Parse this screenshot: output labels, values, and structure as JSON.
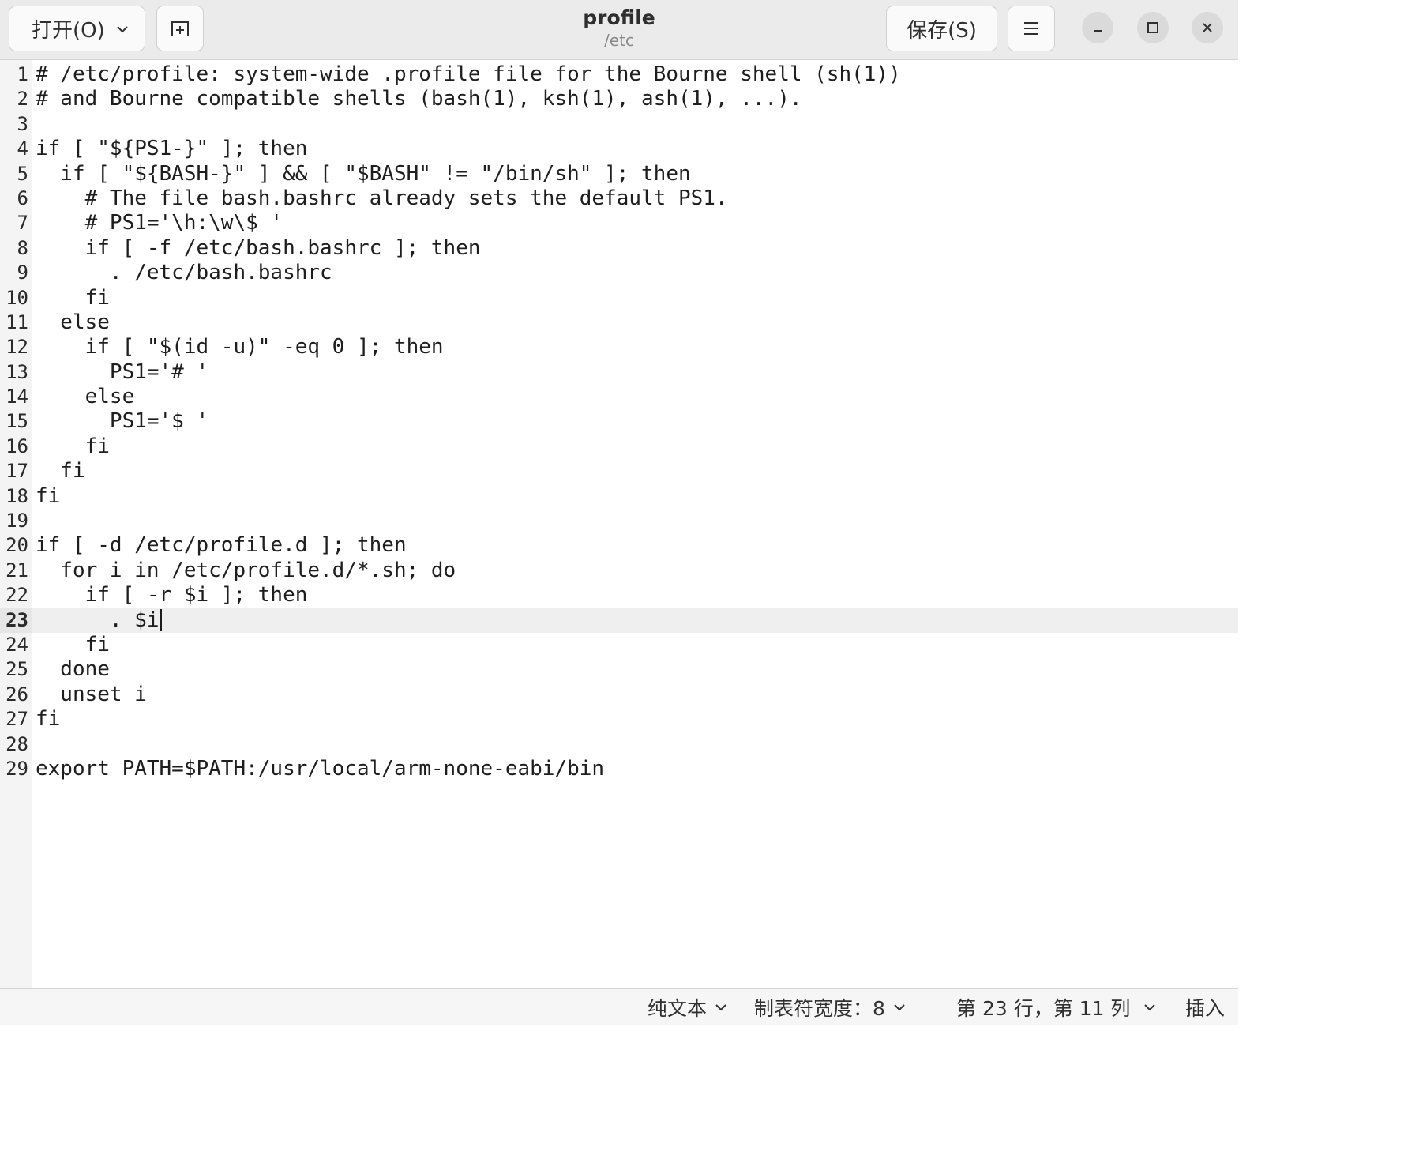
{
  "header": {
    "open_label": "打开(O)",
    "title": "profile",
    "subtitle": "/etc",
    "save_label": "保存(S)"
  },
  "editor": {
    "current_line": 23,
    "lines": [
      {
        "n": "1",
        "text": "# /etc/profile: system-wide .profile file for the Bourne shell (sh(1))"
      },
      {
        "n": "2",
        "text": "# and Bourne compatible shells (bash(1), ksh(1), ash(1), ...)."
      },
      {
        "n": "3",
        "text": ""
      },
      {
        "n": "4",
        "text": "if [ \"${PS1-}\" ]; then"
      },
      {
        "n": "5",
        "text": "  if [ \"${BASH-}\" ] && [ \"$BASH\" != \"/bin/sh\" ]; then"
      },
      {
        "n": "6",
        "text": "    # The file bash.bashrc already sets the default PS1."
      },
      {
        "n": "7",
        "text": "    # PS1='\\h:\\w\\$ '"
      },
      {
        "n": "8",
        "text": "    if [ -f /etc/bash.bashrc ]; then"
      },
      {
        "n": "9",
        "text": "      . /etc/bash.bashrc"
      },
      {
        "n": "10",
        "text": "    fi"
      },
      {
        "n": "11",
        "text": "  else"
      },
      {
        "n": "12",
        "text": "    if [ \"$(id -u)\" -eq 0 ]; then"
      },
      {
        "n": "13",
        "text": "      PS1='# '"
      },
      {
        "n": "14",
        "text": "    else"
      },
      {
        "n": "15",
        "text": "      PS1='$ '"
      },
      {
        "n": "16",
        "text": "    fi"
      },
      {
        "n": "17",
        "text": "  fi"
      },
      {
        "n": "18",
        "text": "fi"
      },
      {
        "n": "19",
        "text": ""
      },
      {
        "n": "20",
        "text": "if [ -d /etc/profile.d ]; then"
      },
      {
        "n": "21",
        "text": "  for i in /etc/profile.d/*.sh; do"
      },
      {
        "n": "22",
        "text": "    if [ -r $i ]; then"
      },
      {
        "n": "23",
        "text": "      . $i"
      },
      {
        "n": "24",
        "text": "    fi"
      },
      {
        "n": "25",
        "text": "  done"
      },
      {
        "n": "26",
        "text": "  unset i"
      },
      {
        "n": "27",
        "text": "fi"
      },
      {
        "n": "28",
        "text": ""
      },
      {
        "n": "29",
        "text": "export PATH=$PATH:/usr/local/arm-none-eabi/bin"
      }
    ]
  },
  "statusbar": {
    "language": "纯文本",
    "tab_width": "制表符宽度：8",
    "position": "第 23 行，第 11 列",
    "mode": "插入"
  }
}
